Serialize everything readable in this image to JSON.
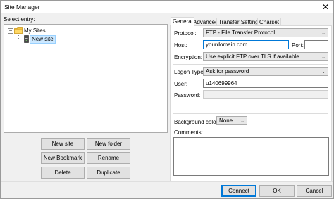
{
  "window": {
    "title": "Site Manager",
    "close_glyph": "✕"
  },
  "left": {
    "select_entry_label": "Select entry:",
    "tree": {
      "root_label": "My Sites",
      "expander_glyph": "−",
      "child_label": "New site"
    },
    "buttons": {
      "new_site": "New site",
      "new_folder": "New folder",
      "new_bookmark": "New Bookmark",
      "rename": "Rename",
      "delete": "Delete",
      "duplicate": "Duplicate"
    }
  },
  "tabs": [
    "General",
    "Advanced",
    "Transfer Settings",
    "Charset"
  ],
  "general": {
    "protocol_label": "Protocol:",
    "protocol_value": "FTP - File Transfer Protocol",
    "host_label": "Host:",
    "host_value": "yourdomain.com",
    "port_label": "Port:",
    "port_value": "",
    "encryption_label": "Encryption:",
    "encryption_value": "Use explicit FTP over TLS if available",
    "logon_type_label": "Logon Type:",
    "logon_type_value": "Ask for password",
    "user_label": "User:",
    "user_value": "u140699964",
    "password_label": "Password:",
    "password_value": "",
    "background_color_label": "Background color:",
    "background_color_value": "None",
    "comments_label": "Comments:",
    "comments_value": "",
    "dropdown_glyph": "⌄"
  },
  "footer": {
    "connect": "Connect",
    "ok": "OK",
    "cancel": "Cancel"
  }
}
